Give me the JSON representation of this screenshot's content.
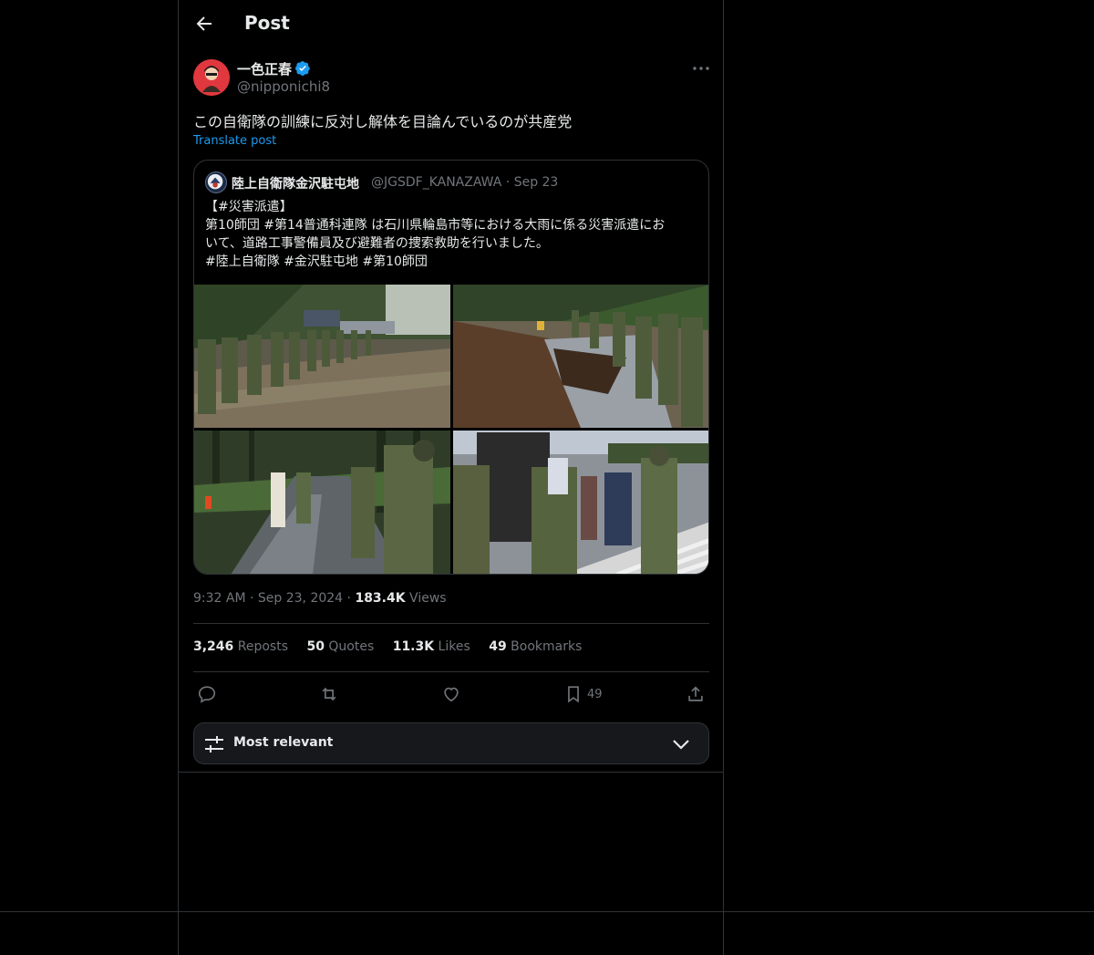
{
  "header": {
    "title": "Post"
  },
  "post": {
    "author_name": "一色正春",
    "author_handle": "@nipponichi8",
    "text": "この自衛隊の訓練に反対し解体を目論んでいるのが共産党",
    "translate_label": "Translate post",
    "time": "9:32 AM",
    "date": "Sep 23, 2024",
    "views_count": "183.4K",
    "views_label": "Views"
  },
  "quote": {
    "author_name": "陸上自衛隊金沢駐屯地",
    "author_handle": "@JGSDF_KANAZAWA",
    "date": "Sep 23",
    "lines": [
      "【#災害派遣】",
      "第10師団 #第14普通科連隊 は石川県輪島市等における大雨に係る災害派遣にお",
      "いて、道路工事警備員及び避難者の捜索救助を行いました。",
      "#陸上自衛隊 #金沢駐屯地 #第10師団"
    ]
  },
  "stats": {
    "reposts_count": "3,246",
    "reposts_label": "Reposts",
    "quotes_count": "50",
    "quotes_label": "Quotes",
    "likes_count": "11.3K",
    "likes_label": "Likes",
    "bookmarks_count": "49",
    "bookmarks_label": "Bookmarks"
  },
  "actions": {
    "bookmark_count": "49"
  },
  "sort": {
    "label": "Most relevant"
  },
  "colors": {
    "accent": "#1d9bf0",
    "background": "#000000",
    "border": "#2f3336",
    "muted": "#71767b"
  }
}
